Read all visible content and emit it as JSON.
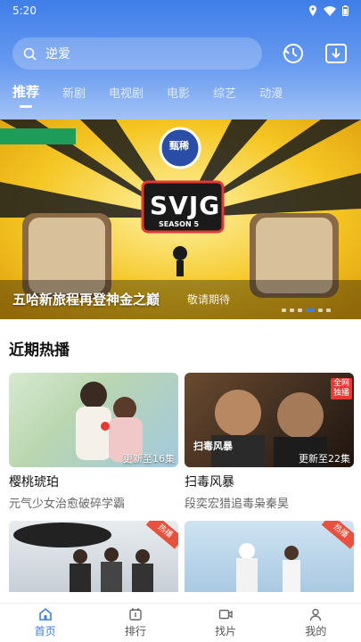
{
  "status": {
    "time": "5:20"
  },
  "search": {
    "text": "逆爱"
  },
  "tabs": [
    {
      "label": "推荐",
      "active": true
    },
    {
      "label": "新剧"
    },
    {
      "label": "电视剧"
    },
    {
      "label": "电影"
    },
    {
      "label": "综艺"
    },
    {
      "label": "动漫"
    }
  ],
  "banner": {
    "caption": "五哈新旅程再登神金之巅",
    "sub": "敬请期待",
    "logo_text": "SVJG",
    "season_text": "SEASON 5",
    "brand_text": "甄稀",
    "dots": 6,
    "active_dot": 4
  },
  "section": {
    "title": "近期热播"
  },
  "cards": [
    {
      "title": "樱桃琥珀",
      "desc": "元气少女治愈破碎学霸",
      "episodes": "更新至16集"
    },
    {
      "title": "扫毒风暴",
      "desc": "段奕宏猎追毒枭秦昊",
      "episodes": "更新至22集",
      "poster_text": "扫毒风暴",
      "corner_badge": "全网独播"
    }
  ],
  "more_cards": [
    {
      "badge": "热播"
    },
    {
      "badge": "热播"
    }
  ],
  "nav": [
    {
      "label": "首页",
      "active": true,
      "icon": "home-icon"
    },
    {
      "label": "排行",
      "icon": "ranking-icon"
    },
    {
      "label": "找片",
      "icon": "video-icon"
    },
    {
      "label": "我的",
      "icon": "user-icon"
    }
  ],
  "colors": {
    "accent": "#3f7ee8",
    "banner_bg": "#f1c21d",
    "badge": "#e8513d"
  }
}
